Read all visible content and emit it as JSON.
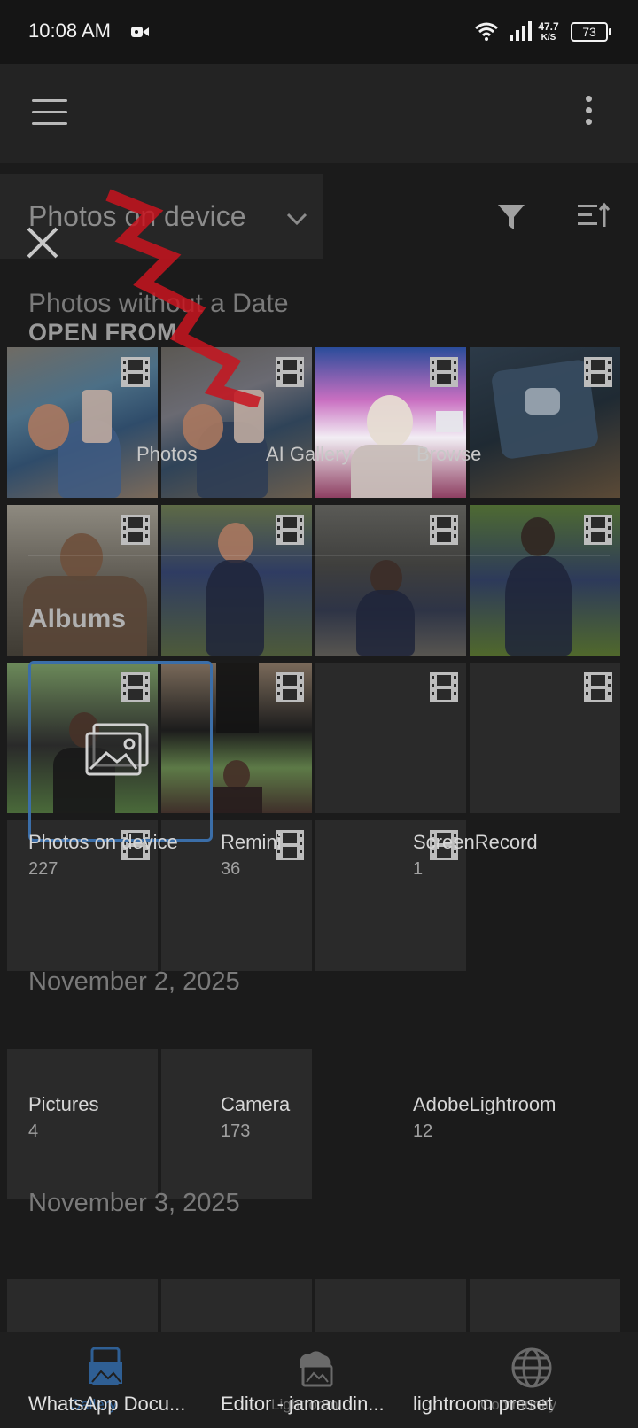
{
  "status": {
    "time": "10:08 AM",
    "speed_value": "47.7",
    "speed_unit": "K/S",
    "battery": "73"
  },
  "toolbar": {
    "title": "Photos on device"
  },
  "overlay": {
    "section_header": "Photos without a Date",
    "open_from": "OPEN FROM",
    "sources": [
      {
        "label": "Photos"
      },
      {
        "label": "AI Gallery"
      },
      {
        "label": "Browse"
      }
    ],
    "albums_heading": "Albums"
  },
  "albums": [
    {
      "name": "Photos on device",
      "count": "227"
    },
    {
      "name": "Remini",
      "count": "36"
    },
    {
      "name": "ScreenRecord",
      "count": "1"
    },
    {
      "name": "Pictures",
      "count": "4"
    },
    {
      "name": "Camera",
      "count": "173"
    },
    {
      "name": "AdobeLightroom",
      "count": "12"
    },
    {
      "name": "WhatsApp Docu...",
      "count": ""
    },
    {
      "name": "Editor - jamaudin...",
      "count": ""
    },
    {
      "name": "lightroom preset",
      "count": ""
    }
  ],
  "dates": {
    "first": "November 2, 2025",
    "second": "November 3, 2025"
  },
  "nav": {
    "items": [
      {
        "label": "Gallery",
        "icon": "gallery-icon",
        "active": true
      },
      {
        "label": "Lightroom",
        "icon": "cloud-photo-icon",
        "active": false
      },
      {
        "label": "Community",
        "icon": "globe-icon",
        "active": false
      }
    ]
  },
  "colors": {
    "background": "#1b1b1b",
    "accent": "#3b6ea8"
  }
}
